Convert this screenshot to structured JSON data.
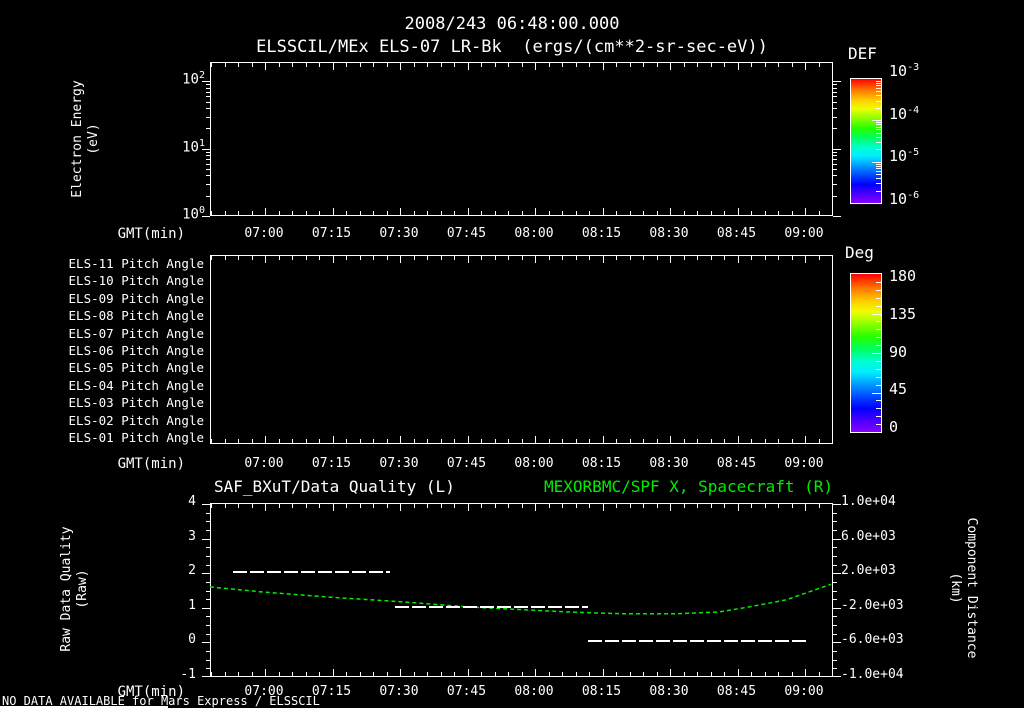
{
  "header": {
    "title_line1": "2008/243 06:48:00.000",
    "title_line2": "ELSSCIL/MEx ELS-07 LR-Bk  (ergs/(cm**2-sr-sec-eV))"
  },
  "colors": {
    "background": "#000000",
    "foreground": "#ffffff",
    "accent_green": "#00ee00"
  },
  "time_axis": {
    "label": "GMT(min)",
    "ticks": [
      "07:00",
      "07:15",
      "07:30",
      "07:45",
      "08:00",
      "08:15",
      "08:30",
      "08:45",
      "09:00"
    ]
  },
  "panel_energy": {
    "ylabel_line1": "Electron Energy",
    "ylabel_line2": "(eV)",
    "yticks": [
      {
        "base": "10",
        "exp": "2"
      },
      {
        "base": "10",
        "exp": "1"
      },
      {
        "base": "10",
        "exp": "0"
      }
    ],
    "colorbar": {
      "title": "DEF",
      "tick_labels": [
        {
          "base": "10",
          "exp": "-3"
        },
        {
          "base": "10",
          "exp": "-4"
        },
        {
          "base": "10",
          "exp": "-5"
        },
        {
          "base": "10",
          "exp": "-6"
        }
      ]
    }
  },
  "panel_pitch": {
    "row_labels": [
      "ELS-11 Pitch Angle",
      "ELS-10 Pitch Angle",
      "ELS-09 Pitch Angle",
      "ELS-08 Pitch Angle",
      "ELS-07 Pitch Angle",
      "ELS-06 Pitch Angle",
      "ELS-05 Pitch Angle",
      "ELS-04 Pitch Angle",
      "ELS-03 Pitch Angle",
      "ELS-02 Pitch Angle",
      "ELS-01 Pitch Angle"
    ],
    "colorbar": {
      "title": "Deg",
      "tick_labels": [
        "180",
        "135",
        "90",
        "45",
        "0"
      ]
    }
  },
  "panel_quality": {
    "title_left": "SAF_BXuT/Data Quality (L)",
    "title_right": "MEXORBMC/SPF X, Spacecraft (R)",
    "ylabel_left_line1": "Raw Data Quality",
    "ylabel_left_line2": "(Raw)",
    "ylabel_right_line1": "Component Distance",
    "ylabel_right_line2": "(km)",
    "yticks_left": [
      "4",
      "3",
      "2",
      "1",
      "0",
      "-1"
    ],
    "yticks_right": [
      "1.0e+04",
      "6.0e+03",
      "2.0e+03",
      "-2.0e+03",
      "-6.0e+03",
      "-1.0e+04"
    ]
  },
  "footer": {
    "no_data_notice": "NO DATA AVAILABLE for Mars Express / ELSSCIL"
  },
  "chart_data": [
    {
      "type": "heatmap",
      "title": "ELSSCIL/MEx ELS-07 LR-Bk",
      "units": "ergs/(cm**2-sr-sec-eV)",
      "xlabel": "GMT(min)",
      "x_range": [
        "06:48",
        "09:06"
      ],
      "x_ticks": [
        "07:00",
        "07:15",
        "07:30",
        "07:45",
        "08:00",
        "08:15",
        "08:30",
        "08:45",
        "09:00"
      ],
      "ylabel": "Electron Energy (eV)",
      "y_scale": "log",
      "y_tick_values": [
        1,
        10,
        100
      ],
      "colorbar": {
        "title": "DEF",
        "scale": "log",
        "tick_values": [
          0.001,
          0.0001,
          1e-05,
          1e-06
        ]
      },
      "values": [],
      "note": "panel empty - no data plotted"
    },
    {
      "type": "heatmap",
      "title": "ELS Pitch Angle",
      "xlabel": "GMT(min)",
      "x_range": [
        "06:48",
        "09:06"
      ],
      "x_ticks": [
        "07:00",
        "07:15",
        "07:30",
        "07:45",
        "08:00",
        "08:15",
        "08:30",
        "08:45",
        "09:00"
      ],
      "rows": [
        "ELS-11",
        "ELS-10",
        "ELS-09",
        "ELS-08",
        "ELS-07",
        "ELS-06",
        "ELS-05",
        "ELS-04",
        "ELS-03",
        "ELS-02",
        "ELS-01"
      ],
      "colorbar": {
        "title": "Deg",
        "tick_values": [
          180,
          135,
          90,
          45,
          0
        ]
      },
      "values": [],
      "note": "panel empty - no data plotted"
    },
    {
      "type": "line",
      "xlabel": "GMT(min)",
      "x_range": [
        "06:48",
        "09:06"
      ],
      "x_ticks": [
        "07:00",
        "07:15",
        "07:30",
        "07:45",
        "08:00",
        "08:15",
        "08:30",
        "08:45",
        "09:00"
      ],
      "axes": {
        "left": {
          "label": "Raw Data Quality (Raw)",
          "range": [
            -1,
            4
          ],
          "ticks": [
            4,
            3,
            2,
            1,
            0,
            -1
          ]
        },
        "right": {
          "label": "Component Distance (km)",
          "range": [
            -10000,
            10000
          ],
          "ticks": [
            10000,
            6000,
            2000,
            -2000,
            -6000,
            -10000
          ]
        }
      },
      "series": [
        {
          "name": "SAF_BXuT/Data Quality (L)",
          "axis": "left",
          "color": "#ffffff",
          "style": "dashed",
          "segments": [
            [
              "06:53",
              "07:28",
              2
            ],
            [
              "07:29",
              "08:12",
              1
            ],
            [
              "08:12",
              "09:01",
              0
            ]
          ]
        },
        {
          "name": "MEXORBMC/SPF X, Spacecraft (R)",
          "axis": "right",
          "color": "#00ee00",
          "style": "dashed",
          "points": [
            [
              "06:48",
              300
            ],
            [
              "07:00",
              -300
            ],
            [
              "07:15",
              -900
            ],
            [
              "07:30",
              -1400
            ],
            [
              "07:45",
              -2000
            ],
            [
              "08:00",
              -2400
            ],
            [
              "08:08",
              -2600
            ],
            [
              "08:19",
              -2800
            ],
            [
              "08:32",
              -2800
            ],
            [
              "08:41",
              -2600
            ],
            [
              "08:48",
              -2000
            ],
            [
              "08:56",
              -1200
            ],
            [
              "09:01",
              -300
            ],
            [
              "09:06",
              600
            ]
          ]
        }
      ]
    }
  ]
}
